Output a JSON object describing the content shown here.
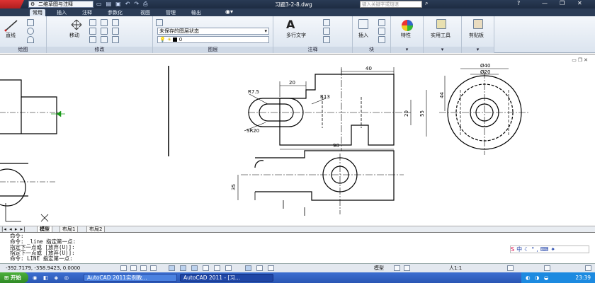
{
  "titlebar": {
    "workspace": "二维草图与注释",
    "doc_title": "习题3-2-8.dwg",
    "search_placeholder": "键入关键字或短语"
  },
  "ribbon_tabs": [
    "常用",
    "插入",
    "注释",
    "参数化",
    "视图",
    "管理",
    "输出"
  ],
  "panels": {
    "draw": {
      "label": "绘图",
      "line_label": "直线"
    },
    "modify": {
      "label": "修改",
      "move_label": "移动"
    },
    "layers": {
      "label": "图层",
      "state": "未保存的图层状态",
      "current_layer": "0"
    },
    "annotation": {
      "label": "注释",
      "mtext_label": "多行文字"
    },
    "block": {
      "label": "块",
      "insert_label": "插入"
    },
    "properties": {
      "label": "特性"
    },
    "utilities": {
      "label": "实用工具"
    },
    "clipboard": {
      "label": "剪贴板"
    }
  },
  "drawing": {
    "dims": {
      "d40": "40",
      "d20": "20",
      "r75": "R7.5",
      "r13": "R13",
      "d20v": "20",
      "d55": "55",
      "sr20": "SR20",
      "d90": "90",
      "dia40": "Ø40",
      "dia20": "Ø20",
      "d44": "44",
      "d35": "35"
    }
  },
  "layout_tabs": [
    "模型",
    "布局1",
    "布局2"
  ],
  "command_lines": [
    "命令:",
    "命令:  _line 指定第一点:",
    "指定下一点或 [放弃(U)]:",
    "指定下一点或 [放弃(U)]:",
    "命令:  LINE 指定第一点:"
  ],
  "status": {
    "coords": "-392.7179, -358.9423, 0.0000",
    "model": "模型",
    "scale": "人1:1"
  },
  "taskbar": {
    "start": "开始",
    "items": [
      "AutoCAD 2011实例教...",
      "AutoCAD 2011 - [习..."
    ],
    "clock": "23:39"
  },
  "colors": {
    "title_bg": "#1e2c42",
    "ribbon_bg": "#dbe4ef",
    "taskbar_bg": "#2a56b4",
    "ucs_green": "#1a9a1a"
  }
}
